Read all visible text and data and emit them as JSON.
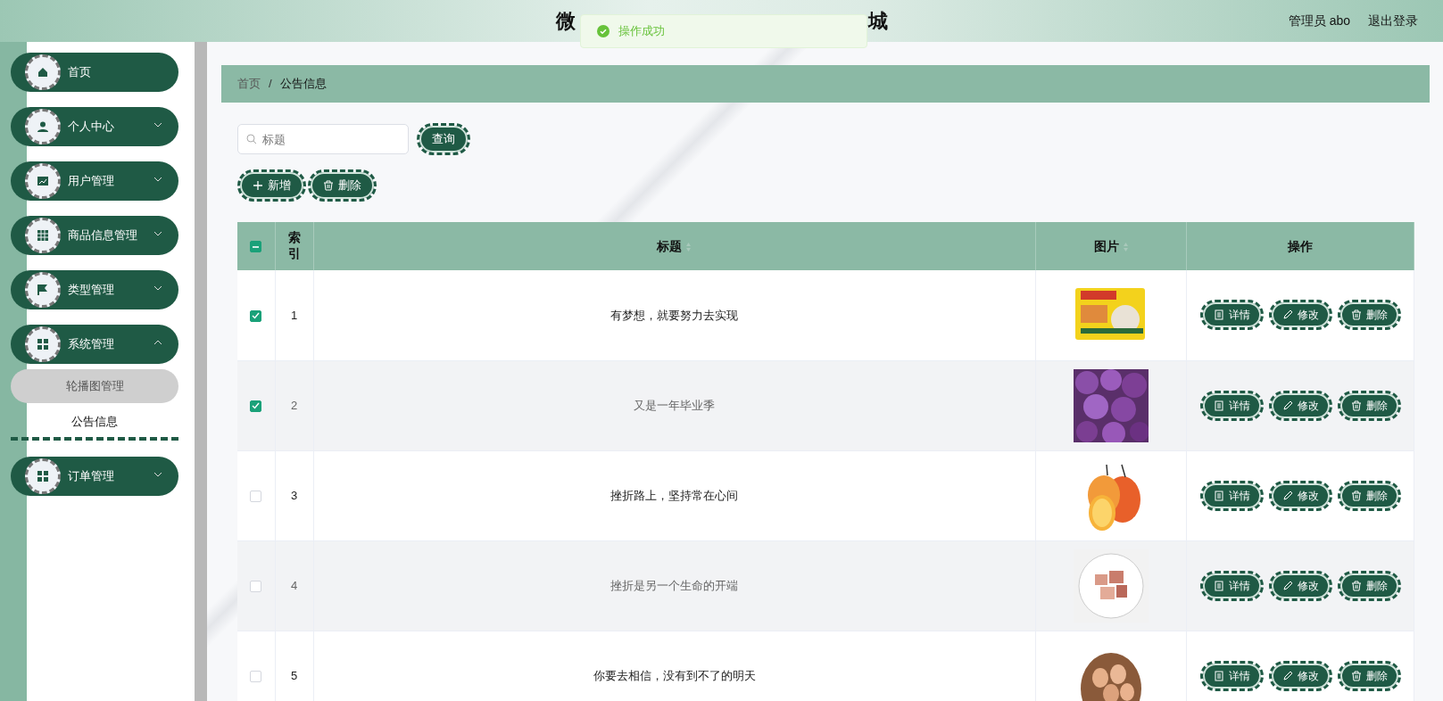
{
  "header": {
    "title_parts": [
      "微",
      "城"
    ],
    "user": "管理员 abo",
    "logout": "退出登录"
  },
  "toast": {
    "text": "操作成功"
  },
  "sidebar": {
    "items": [
      {
        "label": "首页",
        "expandable": false
      },
      {
        "label": "个人中心",
        "expandable": true,
        "expanded": false
      },
      {
        "label": "用户管理",
        "expandable": true,
        "expanded": false
      },
      {
        "label": "商品信息管理",
        "expandable": true,
        "expanded": false
      },
      {
        "label": "类型管理",
        "expandable": true,
        "expanded": false
      },
      {
        "label": "系统管理",
        "expandable": true,
        "expanded": true,
        "children": [
          {
            "label": "轮播图管理",
            "selected": false,
            "highlighted": true
          },
          {
            "label": "公告信息",
            "selected": true,
            "highlighted": false
          }
        ]
      },
      {
        "label": "订单管理",
        "expandable": true,
        "expanded": false
      }
    ]
  },
  "breadcrumb": {
    "items": [
      "首页",
      "公告信息"
    ],
    "separator": "/"
  },
  "search": {
    "placeholder": "标题",
    "button": "查询"
  },
  "actions": [
    {
      "label": "新增",
      "kind": "add"
    },
    {
      "label": "删除",
      "kind": "delete"
    }
  ],
  "table": {
    "header_checkbox": {
      "indeterminate": true
    },
    "columns": [
      {
        "label": "索引",
        "sortable": false
      },
      {
        "label": "标题",
        "sortable": true
      },
      {
        "label": "图片",
        "sortable": true
      },
      {
        "label": "操作",
        "sortable": false
      }
    ],
    "rows": [
      {
        "checked": true,
        "index": "1",
        "title": "有梦想，就要努力去实现",
        "image": {
          "kind": "picture"
        },
        "actions": [
          {
            "label": "详情",
            "kind": "detail"
          },
          {
            "label": "修改",
            "kind": "edit"
          },
          {
            "label": "删除",
            "kind": "delete"
          }
        ]
      },
      {
        "checked": true,
        "index": "2",
        "title": "又是一年毕业季",
        "image": {
          "kind": "picture"
        },
        "actions": [
          {
            "label": "详情",
            "kind": "detail"
          },
          {
            "label": "修改",
            "kind": "edit"
          },
          {
            "label": "删除",
            "kind": "delete"
          }
        ]
      },
      {
        "checked": false,
        "index": "3",
        "title": "挫折路上，坚持常在心间",
        "image": {
          "kind": "picture"
        },
        "actions": [
          {
            "label": "详情",
            "kind": "detail"
          },
          {
            "label": "修改",
            "kind": "edit"
          },
          {
            "label": "删除",
            "kind": "delete"
          }
        ]
      },
      {
        "checked": false,
        "index": "4",
        "title": "挫折是另一个生命的开端",
        "image": {
          "kind": "picture"
        },
        "actions": [
          {
            "label": "详情",
            "kind": "detail"
          },
          {
            "label": "修改",
            "kind": "edit"
          },
          {
            "label": "删除",
            "kind": "delete"
          }
        ]
      },
      {
        "checked": false,
        "index": "5",
        "title": "你要去相信，没有到不了的明天",
        "image": {
          "kind": "picture"
        },
        "actions": [
          {
            "label": "详情",
            "kind": "detail"
          },
          {
            "label": "修改",
            "kind": "edit"
          },
          {
            "label": "删除",
            "kind": "delete"
          }
        ]
      }
    ]
  }
}
